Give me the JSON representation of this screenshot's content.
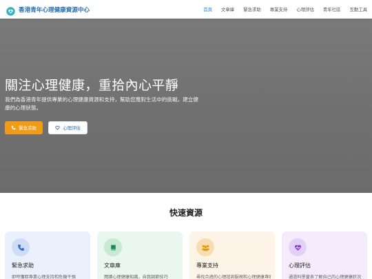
{
  "brand": {
    "title": "香港青年心理健康資源中心",
    "logo_icon": "heart-hands-icon",
    "color": "#2a6fb0"
  },
  "nav": {
    "items": [
      {
        "label": "首頁",
        "active": true
      },
      {
        "label": "文章庫",
        "active": false
      },
      {
        "label": "緊急求助",
        "active": false
      },
      {
        "label": "專業支持",
        "active": false
      },
      {
        "label": "心理評估",
        "active": false
      },
      {
        "label": "青年社區",
        "active": false
      },
      {
        "label": "互動工具",
        "active": false
      }
    ],
    "active_color": "#2a8be0"
  },
  "hero": {
    "title": "關注心理健康，重拾內心平靜",
    "subtitle": "我們為香港青年提供專業的心理健康資源和支持，幫助您應對生活中的挑戰，建立健康的心理狀態。",
    "primary_button": {
      "label": "緊急求助",
      "icon": "phone-icon",
      "color": "#f29b16"
    },
    "secondary_button": {
      "label": "心理評估",
      "icon": "heart-outline-icon"
    }
  },
  "quick": {
    "title": "快速資源",
    "cards": [
      {
        "title": "緊急求助",
        "desc": "即時獲取專業心理支持和危機干預",
        "icon": "phone-icon",
        "accent": "#2f6fd6"
      },
      {
        "title": "文章庫",
        "desc": "閱讀心理健康知識，自我調節技巧",
        "icon": "book-icon",
        "accent": "#1f8a52"
      },
      {
        "title": "專業支持",
        "desc": "尋找合適的心理諮詢服務和心理健康專家",
        "icon": "group-icon",
        "accent": "#e39a12"
      },
      {
        "title": "心理評估",
        "desc": "通過科學量表了解自己的心理健康狀況",
        "icon": "heart-pulse-icon",
        "accent": "#8b3fd0"
      }
    ]
  }
}
